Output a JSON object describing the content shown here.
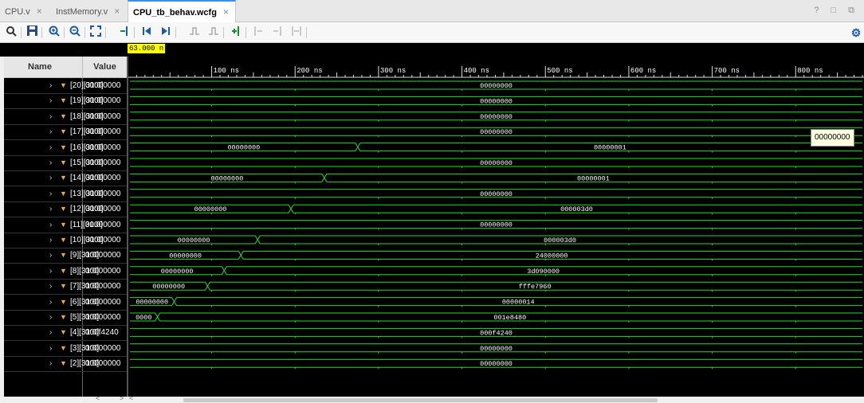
{
  "tabs": [
    {
      "label": "CPU.v",
      "active": false
    },
    {
      "label": "InstMemory.v",
      "active": false
    },
    {
      "label": "CPU_tb_behav.wcfg",
      "active": true
    }
  ],
  "window_controls": "? □ ⧉",
  "toolbar": {
    "icons": [
      "search-icon",
      "save-icon",
      "zoom-in-icon",
      "zoom-out-icon",
      "zoom-fit-icon",
      "go-to-cursor-icon",
      "go-to-start-icon",
      "go-to-end-icon",
      "previous-transition-icon",
      "next-transition-icon",
      "add-marker-icon",
      "previous-marker-icon",
      "next-marker-icon",
      "swap-cursors-icon",
      "settings-icon"
    ]
  },
  "cursor": {
    "time_label": "63.000 n"
  },
  "columns": {
    "name_header": "Name",
    "value_header": "Value"
  },
  "timeline": {
    "tick_labels": [
      "100 ns",
      "200 ns",
      "300 ns",
      "400 ns",
      "500 ns",
      "600 ns",
      "700 ns",
      "800 ns"
    ],
    "tick_times_ns": [
      100,
      200,
      300,
      400,
      500,
      600,
      700,
      800
    ],
    "view_start_ns": 2,
    "view_end_ns": 880
  },
  "signals": [
    {
      "name": "[20][31:0]",
      "value": "00000000",
      "segments": [
        {
          "from": 2,
          "to": 880,
          "label": "00000000"
        }
      ]
    },
    {
      "name": "[19][31:0]",
      "value": "00000000",
      "segments": [
        {
          "from": 2,
          "to": 880,
          "label": "00000000"
        }
      ]
    },
    {
      "name": "[18][31:0]",
      "value": "00000000",
      "segments": [
        {
          "from": 2,
          "to": 880,
          "label": "00000000"
        }
      ]
    },
    {
      "name": "[17][31:0]",
      "value": "00000000",
      "segments": [
        {
          "from": 2,
          "to": 880,
          "label": "00000000"
        }
      ]
    },
    {
      "name": "[16][31:0]",
      "value": "00000000",
      "segments": [
        {
          "from": 2,
          "to": 275,
          "label": "00000000"
        },
        {
          "from": 275,
          "to": 880,
          "label": "00000001"
        }
      ]
    },
    {
      "name": "[15][31:0]",
      "value": "00000000",
      "segments": [
        {
          "from": 2,
          "to": 880,
          "label": "00000000"
        }
      ]
    },
    {
      "name": "[14][31:0]",
      "value": "00000000",
      "segments": [
        {
          "from": 2,
          "to": 235,
          "label": "00000000"
        },
        {
          "from": 235,
          "to": 880,
          "label": "00000001"
        }
      ]
    },
    {
      "name": "[13][31:0]",
      "value": "00000000",
      "segments": [
        {
          "from": 2,
          "to": 880,
          "label": "00000000"
        }
      ]
    },
    {
      "name": "[12][31:0]",
      "value": "00000000",
      "segments": [
        {
          "from": 2,
          "to": 195,
          "label": "00000000"
        },
        {
          "from": 195,
          "to": 880,
          "label": "000003d0"
        }
      ]
    },
    {
      "name": "[11][31:0]",
      "value": "00000000",
      "segments": [
        {
          "from": 2,
          "to": 880,
          "label": "00000000"
        }
      ]
    },
    {
      "name": "[10][31:0]",
      "value": "00000000",
      "segments": [
        {
          "from": 2,
          "to": 155,
          "label": "00000000"
        },
        {
          "from": 155,
          "to": 880,
          "label": "000003d0"
        }
      ]
    },
    {
      "name": "[9][31:0]",
      "value": "00000000",
      "segments": [
        {
          "from": 2,
          "to": 135,
          "label": "00000000"
        },
        {
          "from": 135,
          "to": 880,
          "label": "24000000"
        }
      ]
    },
    {
      "name": "[8][31:0]",
      "value": "00000000",
      "segments": [
        {
          "from": 2,
          "to": 115,
          "label": "00000000"
        },
        {
          "from": 115,
          "to": 880,
          "label": "3d090000"
        }
      ]
    },
    {
      "name": "[7][31:0]",
      "value": "00000000",
      "segments": [
        {
          "from": 2,
          "to": 95,
          "label": "00000000"
        },
        {
          "from": 95,
          "to": 880,
          "label": "fffe7960"
        }
      ]
    },
    {
      "name": "[6][31:0]",
      "value": "00000000",
      "segments": [
        {
          "from": 2,
          "to": 55,
          "label": "00000000"
        },
        {
          "from": 55,
          "to": 880,
          "label": "00000014"
        }
      ]
    },
    {
      "name": "[5][31:0]",
      "value": "00000000",
      "segments": [
        {
          "from": 2,
          "to": 35,
          "label": "0000"
        },
        {
          "from": 35,
          "to": 880,
          "label": "001e8480"
        }
      ]
    },
    {
      "name": "[4][31:0]",
      "value": "000f4240",
      "segments": [
        {
          "from": 2,
          "to": 880,
          "label": "000f4240"
        }
      ]
    },
    {
      "name": "[3][31:0]",
      "value": "00000000",
      "segments": [
        {
          "from": 2,
          "to": 880,
          "label": "00000000"
        }
      ]
    },
    {
      "name": "[2][31:0]",
      "value": "00000000",
      "segments": [
        {
          "from": 2,
          "to": 880,
          "label": "00000000"
        }
      ]
    }
  ],
  "tooltip": {
    "text": "00000000"
  },
  "colors": {
    "wave": "#22dd22",
    "cursor_label_bg": "#ffff00",
    "signal_icon": "#e0b040",
    "active_tab_accent": "#3d8ee0"
  }
}
